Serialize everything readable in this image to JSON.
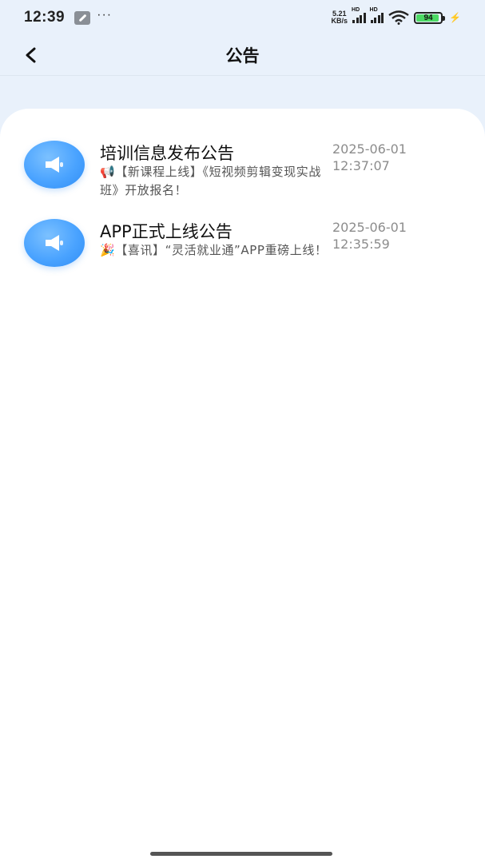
{
  "status_bar": {
    "time": "12:39",
    "dots": "···",
    "net_speed_value": "5.21",
    "net_speed_unit": "KB/s",
    "hd_label_1": "HD",
    "hd_label_2": "HD",
    "battery": "94",
    "battery_level": 0.94,
    "battery_color": "#4cd964"
  },
  "header": {
    "title": "公告",
    "back_icon": "chevron-left-icon"
  },
  "notices": [
    {
      "title": "培训信息发布公告",
      "description": "📢【新课程上线】《短视频剪辑变现实战班》开放报名！",
      "date": "2025-06-01",
      "time": "12:37:07",
      "icon": "megaphone-icon"
    },
    {
      "title": "APP正式上线公告",
      "description": "🎉【喜讯】“灵活就业通”APP重磅上线！",
      "date": "2025-06-01",
      "time": "12:35:59",
      "icon": "megaphone-icon"
    }
  ],
  "colors": {
    "background": "#e9f1fb",
    "icon_blue": "#4aa3ff",
    "time_gray": "#8c8c8c"
  }
}
